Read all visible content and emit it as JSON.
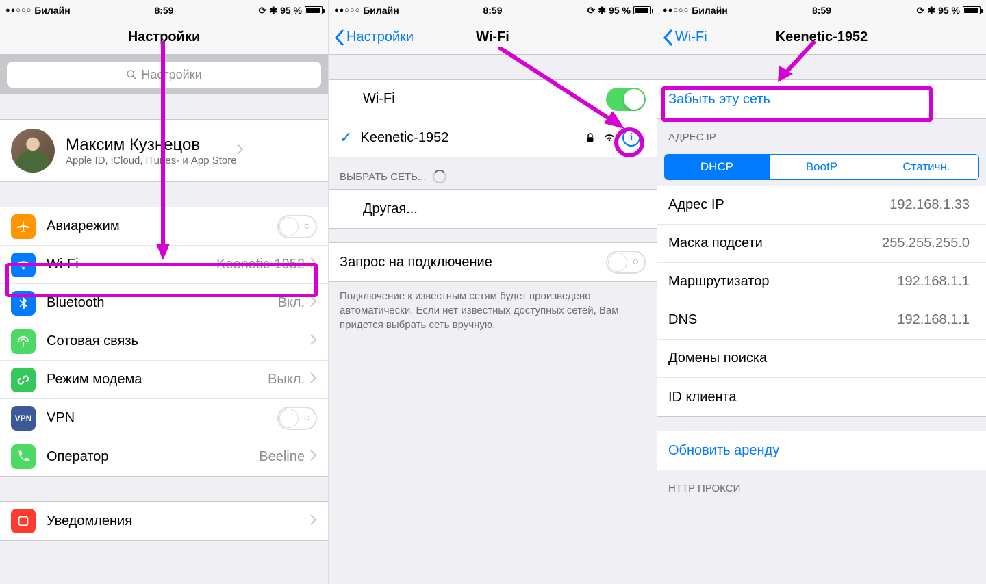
{
  "status": {
    "carrier": "Билайн",
    "time": "8:59",
    "battery": "95 %",
    "signal_dots": "●●○○○"
  },
  "screen1": {
    "title": "Настройки",
    "search_placeholder": "Настройки",
    "profile": {
      "name": "Максим Кузнецов",
      "sub": "Apple ID, iCloud, iTunes- и App Store"
    },
    "rows": {
      "airplane": "Авиарежим",
      "wifi": "Wi-Fi",
      "wifi_value": "Keenetic-1952",
      "bluetooth": "Bluetooth",
      "bluetooth_value": "Вкл.",
      "cellular": "Сотовая связь",
      "hotspot": "Режим модема",
      "hotspot_value": "Выкл.",
      "vpn": "VPN",
      "carrier": "Оператор",
      "carrier_value": "Beeline",
      "notifications": "Уведомления"
    }
  },
  "screen2": {
    "back": "Настройки",
    "title": "Wi-Fi",
    "wifi_label": "Wi-Fi",
    "network": "Keenetic-1952",
    "choose_network": "ВЫБРАТЬ СЕТЬ...",
    "other": "Другая...",
    "ask_join": "Запрос на подключение",
    "footer": "Подключение к известным сетям будет произведено автоматически. Если нет известных доступных сетей, Вам придется выбрать сеть вручную."
  },
  "screen3": {
    "back": "Wi-Fi",
    "title": "Keenetic-1952",
    "forget": "Забыть эту сеть",
    "ip_section": "АДРЕС IP",
    "tabs": {
      "dhcp": "DHCP",
      "bootp": "BootP",
      "static": "Статичн."
    },
    "ip": {
      "label": "Адрес IP",
      "value": "192.168.1.33"
    },
    "mask": {
      "label": "Маска подсети",
      "value": "255.255.255.0"
    },
    "router": {
      "label": "Маршрутизатор",
      "value": "192.168.1.1"
    },
    "dns": {
      "label": "DNS",
      "value": "192.168.1.1"
    },
    "search_domains": "Домены поиска",
    "client_id": "ID клиента",
    "renew": "Обновить аренду",
    "http_proxy": "HTTP ПРОКСИ"
  }
}
